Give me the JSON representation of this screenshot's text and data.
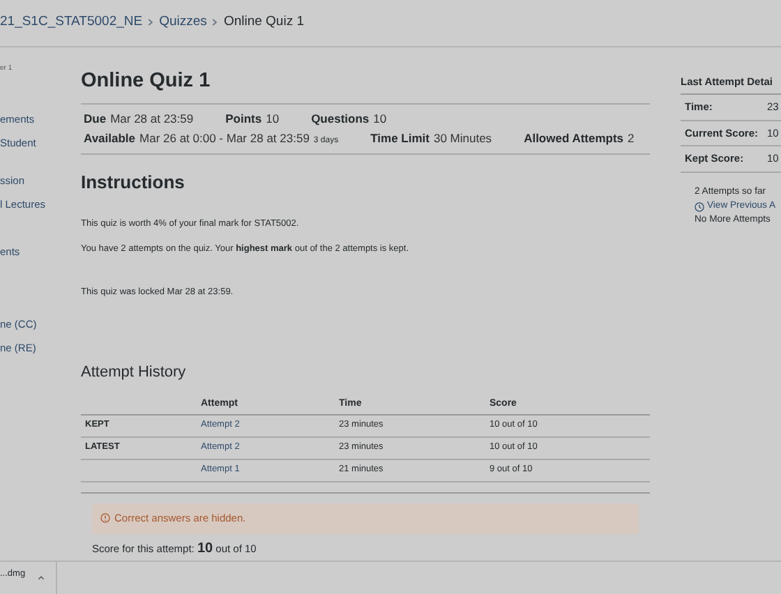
{
  "breadcrumb": [
    {
      "label": "21_S1C_STAT5002_NE",
      "link": true
    },
    {
      "label": "Quizzes",
      "link": true
    },
    {
      "label": "Online Quiz 1",
      "link": false
    }
  ],
  "sidebar": {
    "items": [
      {
        "label": "er 1",
        "kind": "note"
      },
      {
        "label": "ements",
        "kind": "link"
      },
      {
        "label": "Student",
        "kind": "link"
      },
      {
        "label": "ssion",
        "kind": "link"
      },
      {
        "label": "l Lectures",
        "kind": "link"
      },
      {
        "label": "ents",
        "kind": "link"
      },
      {
        "label": "ne (CC)",
        "kind": "link"
      },
      {
        "label": "ne (RE)",
        "kind": "link"
      }
    ]
  },
  "quiz": {
    "title": "Online Quiz 1",
    "details": [
      [
        {
          "label": "Due",
          "value": "Mar 28 at 23:59"
        },
        {
          "label": "Points",
          "value": "10"
        },
        {
          "label": "Questions",
          "value": "10"
        }
      ],
      [
        {
          "label": "Available",
          "value": "Mar 26 at 0:00 - Mar 28 at 23:59",
          "note": "3 days"
        },
        {
          "label": "Time Limit",
          "value": "30 Minutes"
        },
        {
          "label": "Allowed Attempts",
          "value": "2"
        }
      ]
    ]
  },
  "instructions": {
    "heading": "Instructions",
    "paragraphs": [
      "This quiz is worth 4% of your final mark for STAT5002.",
      "You have 2 attempts on the quiz. Your **highest mark** out of the 2 attempts is kept."
    ],
    "lock_notice": "This quiz was locked Mar 28 at 23:59."
  },
  "attempt_history": {
    "heading": "Attempt History",
    "columns": [
      "Attempt",
      "Time",
      "Score"
    ],
    "rows": [
      {
        "label": "KEPT",
        "attempt": "Attempt 2",
        "time": "23 minutes",
        "score": "10 out of 10"
      },
      {
        "label": "LATEST",
        "attempt": "Attempt 2",
        "time": "23 minutes",
        "score": "10 out of 10"
      },
      {
        "attempt": "Attempt 1",
        "time": "21 minutes",
        "score": "9 out of 10"
      }
    ]
  },
  "alert": {
    "text": "Correct answers are hidden."
  },
  "score_line": "Score for this attempt: **10** out of 10",
  "last_attempt": {
    "heading": "Last Attempt Detai",
    "rows": [
      {
        "label": "Time:",
        "value": "23"
      },
      {
        "label": "Current Score:",
        "value": "10"
      },
      {
        "label": "Kept Score:",
        "value": "10"
      }
    ],
    "attempts_so_far": "2 Attempts so far",
    "view_previous": "View Previous A",
    "no_more": "No More Attempts"
  },
  "download_bar": {
    "file": "...dmg"
  }
}
